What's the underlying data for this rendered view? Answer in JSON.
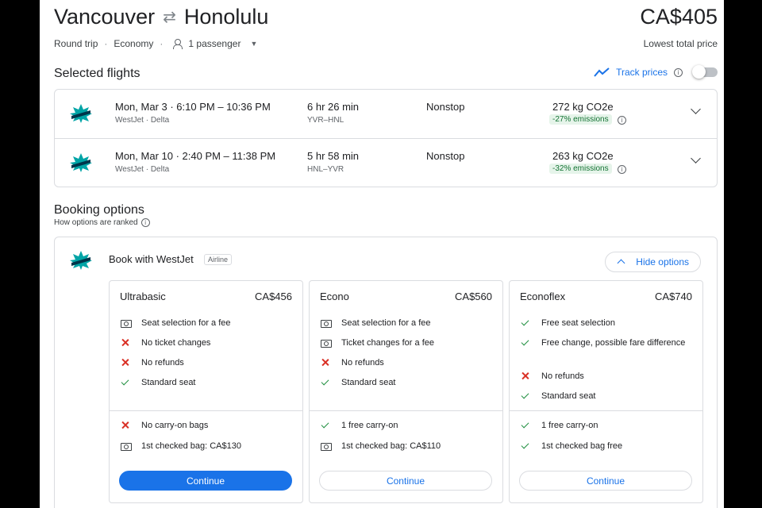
{
  "header": {
    "origin": "Vancouver",
    "swap_icon": "⇄",
    "destination": "Honolulu",
    "trip_type": "Round trip",
    "cabin": "Economy",
    "passengers": "1 passenger",
    "price": "CA$405",
    "price_label": "Lowest total price"
  },
  "selected": {
    "title": "Selected flights",
    "track_label": "Track prices",
    "flights": [
      {
        "time": "Mon, Mar 3 · 6:10 PM – 10:36 PM",
        "airlines": "WestJet · Delta",
        "duration": "6 hr 26 min",
        "codes": "YVR–HNL",
        "stops": "Nonstop",
        "emissions": "272 kg CO2e",
        "badge": "-27% emissions"
      },
      {
        "time": "Mon, Mar 10 · 2:40 PM – 11:38 PM",
        "airlines": "WestJet · Delta",
        "duration": "5 hr 58 min",
        "codes": "HNL–YVR",
        "stops": "Nonstop",
        "emissions": "263 kg CO2e",
        "badge": "-32% emissions"
      }
    ]
  },
  "booking": {
    "title": "Booking options",
    "ranked": "How options are ranked",
    "book_with": "Book with WestJet",
    "airline_tag": "Airline",
    "hide_label": "Hide options",
    "fares": [
      {
        "name": "Ultrabasic",
        "price": "CA$456",
        "button": "Continue",
        "features": [
          {
            "icon": "fee",
            "text": "Seat selection for a fee"
          },
          {
            "icon": "cross",
            "text": "No ticket changes"
          },
          {
            "icon": "cross",
            "text": "No refunds"
          },
          {
            "icon": "check",
            "text": "Standard seat"
          }
        ],
        "bags": [
          {
            "icon": "cross",
            "text": "No carry-on bags"
          },
          {
            "icon": "fee",
            "text": "1st checked bag: CA$130"
          }
        ]
      },
      {
        "name": "Econo",
        "price": "CA$560",
        "button": "Continue",
        "features": [
          {
            "icon": "fee",
            "text": "Seat selection for a fee"
          },
          {
            "icon": "fee",
            "text": "Ticket changes for a fee"
          },
          {
            "icon": "cross",
            "text": "No refunds"
          },
          {
            "icon": "check",
            "text": "Standard seat"
          }
        ],
        "bags": [
          {
            "icon": "check",
            "text": "1 free carry-on"
          },
          {
            "icon": "fee",
            "text": "1st checked bag: CA$110"
          }
        ]
      },
      {
        "name": "Econoflex",
        "price": "CA$740",
        "button": "Continue",
        "features": [
          {
            "icon": "check",
            "text": "Free seat selection"
          },
          {
            "icon": "check",
            "text": "Free change, possible fare difference"
          },
          {
            "icon": "cross",
            "text": "No refunds"
          },
          {
            "icon": "check",
            "text": "Standard seat"
          }
        ],
        "bags": [
          {
            "icon": "check",
            "text": "1 free carry-on"
          },
          {
            "icon": "check",
            "text": "1st checked bag free"
          }
        ]
      }
    ]
  },
  "colors": {
    "accent": "#1a73e8",
    "success": "#1e8e3e",
    "danger": "#d93025",
    "logo": "#00a4a6"
  }
}
